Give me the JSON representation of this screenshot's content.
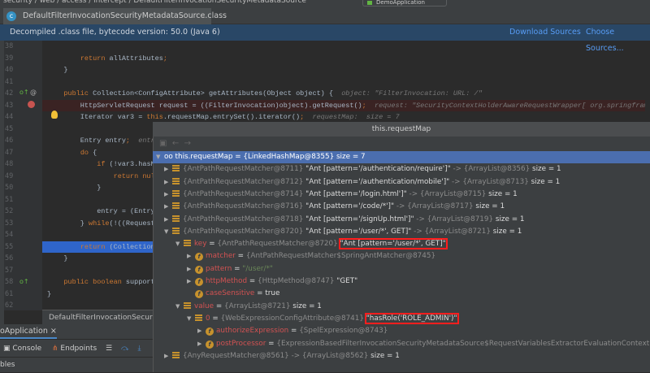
{
  "breadcrumb": "security / web / access / intercept / DefaultFilterInvocationSecurityMetadataSource",
  "run_config": "DemoApplication",
  "tab": {
    "label": "DefaultFilterInvocationSecurityMetadataSource.class",
    "icon": "class-icon",
    "close": "×"
  },
  "banner": {
    "text": "Decompiled .class file, bytecode version: 50.0 (Java 6)",
    "download": "Download Sources",
    "choose": "Choose Sources..."
  },
  "code": [
    {
      "n": "38",
      "t": []
    },
    {
      "n": "39",
      "t": [
        [
          "        ",
          "pl"
        ],
        [
          "return ",
          "kw"
        ],
        [
          "allAttributes",
          "pl"
        ],
        [
          ";",
          "kw"
        ]
      ]
    },
    {
      "n": "40",
      "t": [
        [
          "    }",
          "pl"
        ]
      ]
    },
    {
      "n": "41",
      "t": []
    },
    {
      "n": "42",
      "t": [
        [
          "    ",
          "pl"
        ],
        [
          "public ",
          "kw"
        ],
        [
          "Collection<ConfigAttribute> getAttributes(Object object) {  ",
          "pl"
        ],
        [
          "object: \"FilterInvocation: URL: /\"",
          "hint"
        ]
      ]
    },
    {
      "n": "43",
      "t": [
        [
          "        HttpServletRequest request = ((FilterInvocation)object).getRequest()",
          "pl"
        ],
        [
          ";  ",
          "kw"
        ],
        [
          "request: \"SecurityContextHolderAwareRequestWrapper[ org.springfram",
          "hint"
        ]
      ]
    },
    {
      "n": "44",
      "t": [
        [
          "        Iterator var3 = ",
          "pl"
        ],
        [
          "this",
          "kw"
        ],
        [
          ".requestMap.entrySet().iterator()",
          "pl"
        ],
        [
          ";  ",
          "kw"
        ],
        [
          "requestMap:  size = 7",
          "hint"
        ]
      ]
    },
    {
      "n": "45",
      "t": []
    },
    {
      "n": "46",
      "t": [
        [
          "        Entry entry",
          "pl"
        ],
        [
          ";  ",
          "kw"
        ],
        [
          "entr",
          "hint"
        ]
      ]
    },
    {
      "n": "47",
      "t": [
        [
          "        ",
          "pl"
        ],
        [
          "do ",
          "kw"
        ],
        [
          "{",
          "pl"
        ]
      ]
    },
    {
      "n": "48",
      "t": [
        [
          "            ",
          "pl"
        ],
        [
          "if ",
          "kw"
        ],
        [
          "(!var3.hasN",
          "pl"
        ]
      ]
    },
    {
      "n": "49",
      "t": [
        [
          "                ",
          "pl"
        ],
        [
          "return nul",
          "kw"
        ]
      ]
    },
    {
      "n": "50",
      "t": [
        [
          "            }",
          "pl"
        ]
      ]
    },
    {
      "n": "51",
      "t": []
    },
    {
      "n": "52",
      "t": [
        [
          "            entry = (Entry",
          "pl"
        ]
      ]
    },
    {
      "n": "53",
      "t": [
        [
          "        } ",
          "pl"
        ],
        [
          "while",
          "kw"
        ],
        [
          "(!((Request",
          "pl"
        ]
      ]
    },
    {
      "n": "54",
      "t": []
    },
    {
      "n": "55",
      "t": [
        [
          "        ",
          "pl"
        ],
        [
          "return ",
          "kw"
        ],
        [
          "(Collection",
          "pl"
        ]
      ]
    },
    {
      "n": "56",
      "t": [
        [
          "    }",
          "pl"
        ]
      ]
    },
    {
      "n": "57",
      "t": []
    },
    {
      "n": "58",
      "t": [
        [
          "    ",
          "pl"
        ],
        [
          "public boolean ",
          "kw"
        ],
        [
          "support",
          "pl"
        ]
      ]
    },
    {
      "n": "61",
      "t": [
        [
          "}",
          "pl"
        ]
      ]
    },
    {
      "n": "62",
      "t": []
    }
  ],
  "popup": {
    "title": "this.requestMap",
    "root": "oo this.requestMap = {LinkedHashMap@8355}  size = 7",
    "entries": [
      {
        "obj": "{AntPathRequestMatcher@8711}",
        "str": "\"Ant [pattern='/authentication/require']\"",
        "val": "-> {ArrayList@8356}",
        "size": "size = 1"
      },
      {
        "obj": "{AntPathRequestMatcher@8712}",
        "str": "\"Ant [pattern='/authentication/mobile']\"",
        "val": "-> {ArrayList@8713}",
        "size": "size = 1"
      },
      {
        "obj": "{AntPathRequestMatcher@8714}",
        "str": "\"Ant [pattern='/login.html']\"",
        "val": "-> {ArrayList@8715}",
        "size": "size = 1"
      },
      {
        "obj": "{AntPathRequestMatcher@8716}",
        "str": "\"Ant [pattern='/code/*']\"",
        "val": "-> {ArrayList@8717}",
        "size": "size = 1"
      },
      {
        "obj": "{AntPathRequestMatcher@8718}",
        "str": "\"Ant [pattern='/signUp.html']\"",
        "val": "-> {ArrayList@8719}",
        "size": "size = 1"
      },
      {
        "obj": "{AntPathRequestMatcher@8720}",
        "str": "\"Ant [pattern='/user/*', GET]\"",
        "val": "-> {ArrayList@8721}",
        "size": "size = 1"
      }
    ],
    "key": {
      "name": "key",
      "eq": " = ",
      "obj": "{AntPathRequestMatcher@8720}",
      "str": "\"Ant [pattern='/user/*', GET]\""
    },
    "key_fields": [
      {
        "name": "matcher",
        "eq": " = ",
        "rest": "{AntPathRequestMatcher$SpringAntMatcher@8745}",
        "str": ""
      },
      {
        "name": "pattern",
        "eq": " = ",
        "rest": "",
        "str": "\"/user/*\""
      },
      {
        "name": "httpMethod",
        "eq": " = ",
        "rest": "{HttpMethod@8747}",
        "str": "\"GET\""
      },
      {
        "name": "caseSensitive",
        "eq": " = ",
        "rest": "",
        "str": "true"
      }
    ],
    "value": {
      "name": "value",
      "eq": " = ",
      "obj": "{ArrayList@8721}",
      "size": "size = 1"
    },
    "item0": {
      "name": "0",
      "eq": " = ",
      "obj": "{WebExpressionConfigAttribute@8741}",
      "str": "\"hasRole('ROLE_ADMIN')\""
    },
    "item_fields": [
      {
        "name": "authorizeExpression",
        "eq": " = ",
        "rest": "{SpelExpression@8743}"
      },
      {
        "name": "postProcessor",
        "eq": " = ",
        "rest": "{ExpressionBasedFilterInvocationSecurityMetadataSource$RequestVariablesExtractorEvaluationContextPostProcessor"
      }
    ],
    "last": {
      "obj": "{AnyRequestMatcher@8561}",
      "val": "-> {ArrayList@8562}",
      "size": "size = 1"
    }
  },
  "status": "DefaultFilterInvocationSecurityMetadataSource",
  "run_tab": "oApplication ×",
  "debug_tabs": {
    "console": "Console",
    "endpoints": "Endpoints"
  },
  "vars_label": "bles"
}
